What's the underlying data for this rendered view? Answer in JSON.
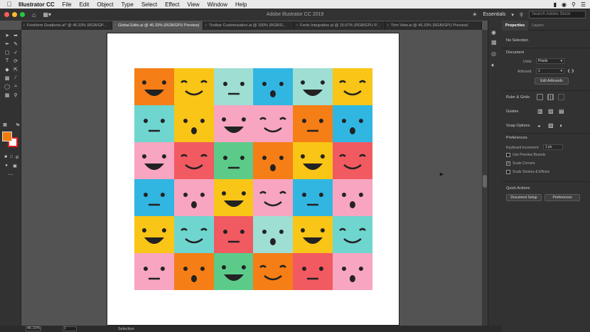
{
  "menubar": {
    "app": "Illustrator CC",
    "items": [
      "File",
      "Edit",
      "Object",
      "Type",
      "Select",
      "Effect",
      "View",
      "Window",
      "Help"
    ]
  },
  "appbar": {
    "title": "Adobe Illustrator CC 2019",
    "workspace": "Essentials",
    "search_placeholder": "Search Adobe Stock"
  },
  "tabs": [
    "Freeform Gradients.ai* @ 46.33% (RGB/GP...",
    "Global Edits.ai @ 46.33% (RGB/GPU Preview)",
    "Toolbar Customisation.ai @ 100% (RGB/G...",
    "Fonts Integration.ai @ 15.67% (RGB/GPU P...",
    "Trim View.ai @ 46.33% (RGB/GPU Preview)"
  ],
  "panel": {
    "tabs": [
      "Properties",
      "Layers"
    ],
    "no_selection": "No Selection",
    "document": "Document",
    "units_label": "Units:",
    "units_value": "Pixels",
    "artboard_label": "Artboard:",
    "artboard_value": "1",
    "edit_artboards": "Edit Artboards",
    "rulers_grids": "Ruler & Grids",
    "guides": "Guides",
    "snap_options": "Snap Options",
    "preferences_title": "Preferences",
    "keyboard_increment_label": "Keyboard Increment:",
    "keyboard_increment_value": "1 px",
    "use_preview_bounds": "Use Preview Bounds",
    "scale_corners": "Scale Corners",
    "scale_strokes": "Scale Strokes & Effects",
    "quick_actions": "Quick Actions",
    "document_setup": "Document Setup",
    "preferences_btn": "Preferences"
  },
  "statusbar": {
    "zoom": "46.33%",
    "page": "1",
    "status": "Selection"
  },
  "colors": {
    "fill": "#f07c0f",
    "stroke": "#e02020"
  },
  "emoji_grid": [
    [
      "#f57e16",
      "#f9c516",
      "#9fded3",
      "#31b6e2",
      "#9fded3",
      "#f9c516"
    ],
    [
      "#6ed6cf",
      "#f9c516",
      "#f7a5c0",
      "#f7a5c0",
      "#f57e16",
      "#31b6e2"
    ],
    [
      "#f7a5c0",
      "#f25a62",
      "#5ccb8a",
      "#f57e16",
      "#f9c516",
      "#f25a62"
    ],
    [
      "#31b6e2",
      "#f7a5c0",
      "#f9c516",
      "#f7a5c0",
      "#31b6e2",
      "#f7a5c0"
    ],
    [
      "#f9c516",
      "#6ed6cf",
      "#f25a62",
      "#9fded3",
      "#f9c516",
      "#6ed6cf"
    ],
    [
      "#f7a5c0",
      "#f57e16",
      "#5ccb8a",
      "#f57e16",
      "#f25a62",
      "#f7a5c0"
    ]
  ]
}
